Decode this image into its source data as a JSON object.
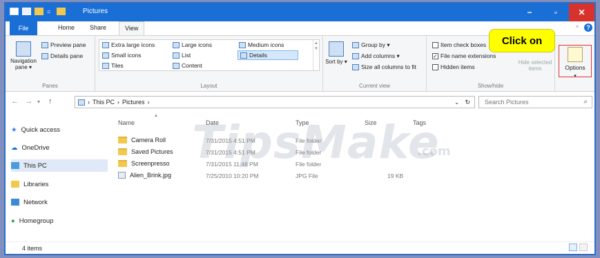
{
  "window": {
    "title": "Pictures",
    "min": "−",
    "max": "▫",
    "close": "✕"
  },
  "tabs": {
    "file": "File",
    "home": "Home",
    "share": "Share",
    "view": "View"
  },
  "ribbon": {
    "panes": {
      "navigation_pane": "Navigation pane ▾",
      "preview_pane": "Preview pane",
      "details_pane": "Details pane",
      "label": "Panes"
    },
    "layout": {
      "extra_large": "Extra large icons",
      "large": "Large icons",
      "medium": "Medium icons",
      "small": "Small icons",
      "list": "List",
      "details": "Details",
      "tiles": "Tiles",
      "content": "Content",
      "label": "Layout"
    },
    "current_view": {
      "sort_by": "Sort by ▾",
      "group_by": "Group by ▾",
      "add_columns": "Add columns ▾",
      "size_all": "Size all columns to fit",
      "label": "Current view"
    },
    "show_hide": {
      "item_check_boxes": "Item check boxes",
      "file_name_extensions": "File name extensions",
      "hidden_items": "Hidden items",
      "hide_selected": "Hide selected items",
      "label": "Show/hide",
      "item_check_boxes_checked": false,
      "file_name_extensions_checked": true,
      "hidden_items_checked": false
    },
    "options": "Options"
  },
  "callout": "Click on",
  "address": {
    "back": "←",
    "forward": "→",
    "recent": "▾",
    "up": "↑",
    "path": [
      "This PC",
      "Pictures"
    ],
    "refresh": "↻",
    "search_placeholder": "Search Pictures"
  },
  "nav": [
    "Quick access",
    "OneDrive",
    "This PC",
    "Libraries",
    "Network",
    "Homegroup"
  ],
  "columns": [
    "Name",
    "Date",
    "Type",
    "Size",
    "Tags"
  ],
  "files": [
    {
      "name": "Camera Roll",
      "date": "7/31/2015 4:51 PM",
      "type": "File folder",
      "size": "",
      "kind": "folder"
    },
    {
      "name": "Saved Pictures",
      "date": "7/31/2015 4:51 PM",
      "type": "File folder",
      "size": "",
      "kind": "folder"
    },
    {
      "name": "Screenpresso",
      "date": "7/31/2015 11:48 PM",
      "type": "File folder",
      "size": "",
      "kind": "folder"
    },
    {
      "name": "Alien_Brink.jpg",
      "date": "7/25/2010 10:20 PM",
      "type": "JPG File",
      "size": "19 KB",
      "kind": "file"
    }
  ],
  "status": {
    "count": "4 items"
  },
  "watermark": {
    "main": "TipsMake",
    "domain": ".com"
  },
  "colors": {
    "accent": "#1a6fd6",
    "callout": "#ffff00",
    "highlight": "#e03030"
  }
}
